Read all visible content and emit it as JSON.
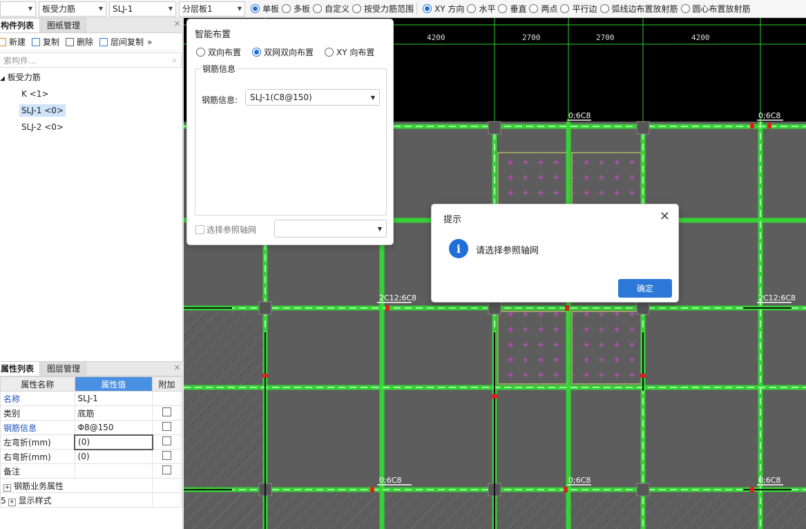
{
  "toolbar": {
    "combo_floor": "",
    "combo_type": "板受力筋",
    "combo_name": "SLJ-1",
    "combo_layer": "分层板1",
    "radios": [
      "单板",
      "多板",
      "自定义",
      "按受力筋范围",
      "XY 方向",
      "水平",
      "垂直",
      "两点",
      "平行边",
      "弧线边布置放射筋",
      "圆心布置放射筋"
    ]
  },
  "component_panel": {
    "tabs": [
      "构件列表",
      "图纸管理"
    ],
    "buttons": [
      "新建",
      "复制",
      "删除",
      "层间复制"
    ],
    "more": "»",
    "search_placeholder": "索构件...",
    "tree_root": "板受力筋",
    "items": [
      "K <1>",
      "SLJ-1 <0>",
      "SLJ-2 <0>"
    ]
  },
  "property_panel": {
    "tabs": [
      "属性列表",
      "图层管理"
    ],
    "headers": [
      "属性名称",
      "属性值",
      "附加"
    ],
    "rows": [
      {
        "name": "名称",
        "value": "SLJ-1"
      },
      {
        "name": "类别",
        "value": "底筋"
      },
      {
        "name": "钢筋信息",
        "value": "Φ8@150"
      },
      {
        "name": "左弯折(mm)",
        "value": "(0)"
      },
      {
        "name": "右弯折(mm)",
        "value": "(0)"
      },
      {
        "name": "备注",
        "value": ""
      },
      {
        "name": "钢筋业务属性",
        "value": ""
      },
      {
        "name": "显示样式",
        "value": ""
      }
    ],
    "row_index": "5",
    "expand": "+"
  },
  "canvas": {
    "dims": [
      "4200",
      "2700",
      "2700",
      "4200"
    ],
    "labels": [
      "0;6C8",
      "0;6C8",
      "2C12;6C8",
      "2C12;6C8",
      "0;6C8",
      "0;6C8",
      "0;6C8"
    ]
  },
  "smart_dialog": {
    "title": "智能布置",
    "options": [
      "双向布置",
      "双网双向布置",
      "XY 向布置"
    ],
    "group_title": "钢筋信息",
    "rebar_label": "钢筋信息:",
    "rebar_value": "SLJ-1(C8@150)",
    "ref_label": "选择参照轴网"
  },
  "message": {
    "title": "提示",
    "text": "请选择参照轴网",
    "ok": "确定",
    "info_glyph": "i"
  }
}
